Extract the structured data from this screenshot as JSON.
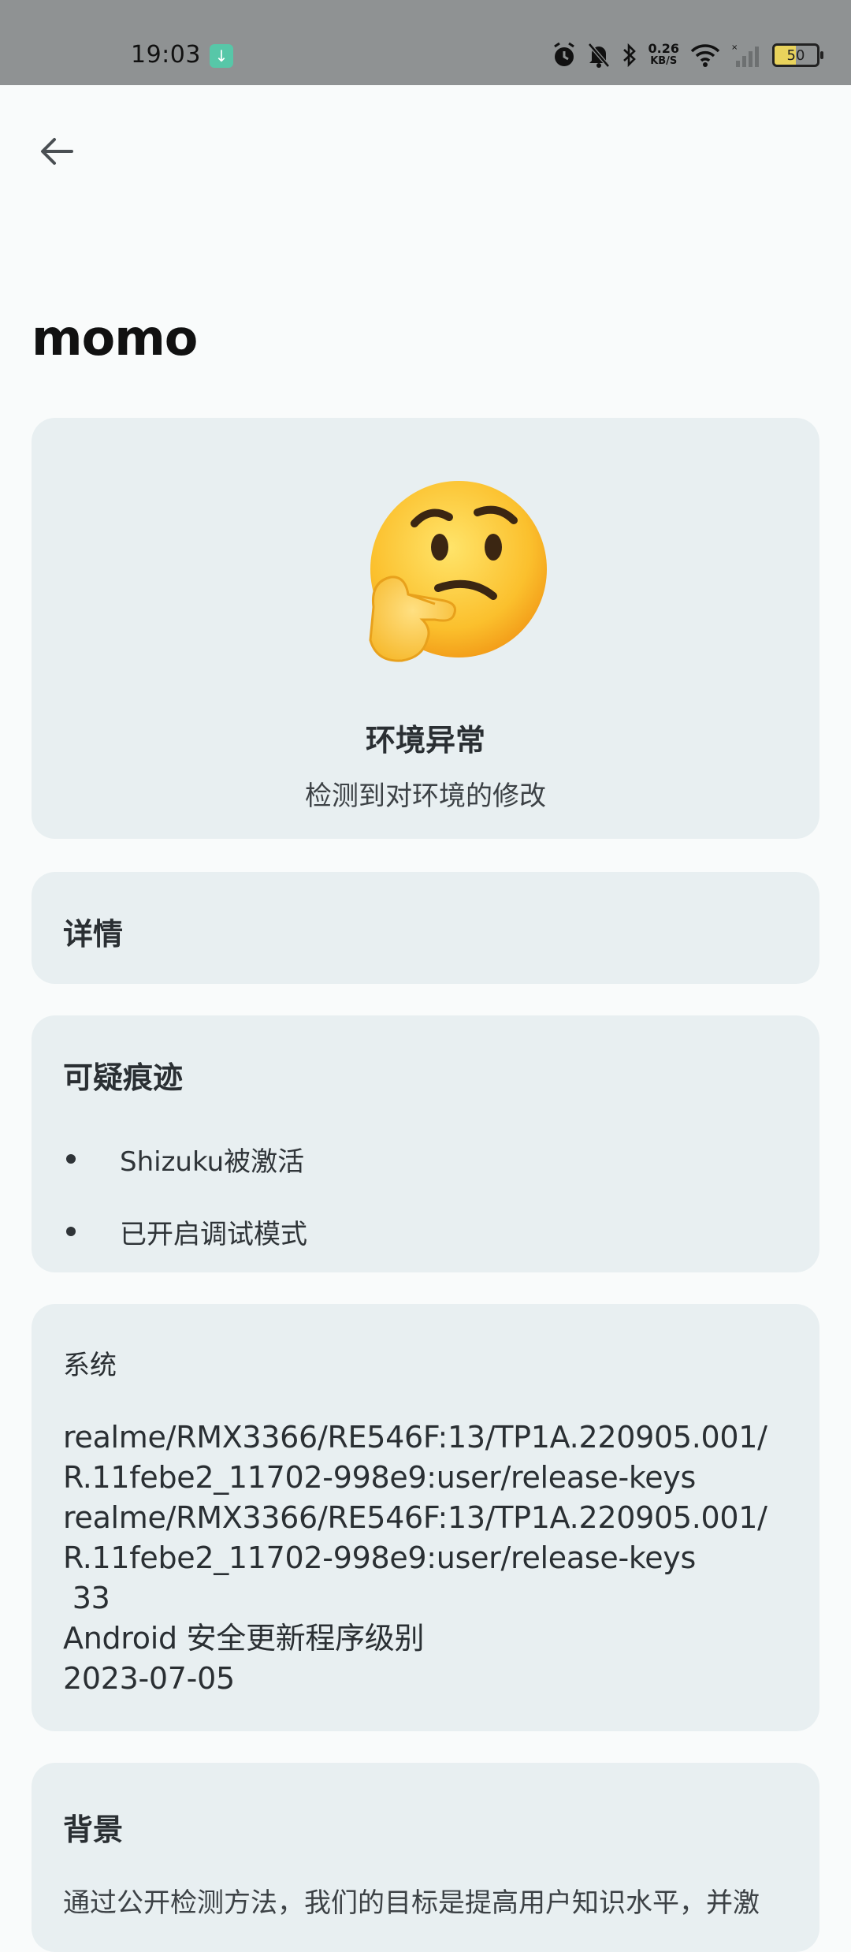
{
  "status_bar": {
    "time": "19:03",
    "net_speed_value": "0.26",
    "net_speed_unit": "KB/S",
    "battery_level": "50"
  },
  "header": {
    "back_icon": "arrow-left-icon",
    "title": "momo"
  },
  "status_card": {
    "emoji": "thinking-face-icon",
    "title": "环境异常",
    "subtitle": "检测到对环境的修改"
  },
  "details_card": {
    "title": "详情"
  },
  "traces_card": {
    "title": "可疑痕迹",
    "items": [
      {
        "label": "Shizuku被激活"
      },
      {
        "label": "已开启调试模式"
      }
    ]
  },
  "system_card": {
    "title": "系统",
    "lines": [
      "realme/RMX3366/RE546F:13/TP1A.220905.001/",
      "R.11febe2_11702-998e9:user/release-keys",
      "realme/RMX3366/RE546F:13/TP1A.220905.001/",
      "R.11febe2_11702-998e9:user/release-keys",
      " 33",
      "Android 安全更新程序级别",
      "2023-07-05"
    ]
  },
  "background_card": {
    "title": "背景",
    "text": "通过公开检测方法，我们的目标是提高用户知识水平，并激"
  },
  "colors": {
    "page_bg": "#f9fbfb",
    "card_bg": "#e8eff1",
    "status_bar_bg": "#8f9293"
  }
}
